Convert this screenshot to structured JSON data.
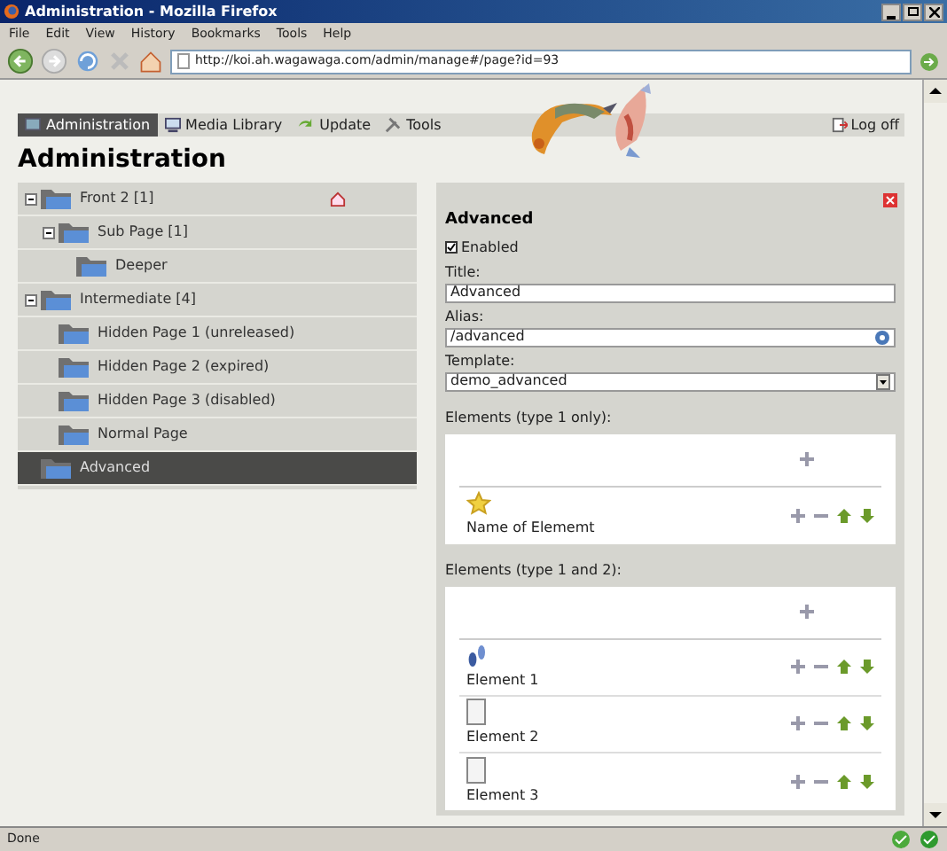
{
  "window": {
    "title": "Administration - Mozilla Firefox"
  },
  "menu": [
    "File",
    "Edit",
    "View",
    "History",
    "Bookmarks",
    "Tools",
    "Help"
  ],
  "address": {
    "value": "http://koi.ah.wagawaga.com/admin/manage#/page?id=93"
  },
  "nav": [
    {
      "label": "Administration",
      "selected": true,
      "kind": "admin"
    },
    {
      "label": "Media Library",
      "selected": false,
      "kind": "media"
    },
    {
      "label": "Update",
      "selected": false,
      "kind": "update"
    },
    {
      "label": "Tools",
      "selected": false,
      "kind": "tools"
    }
  ],
  "logoff": "Log off",
  "heading": "Administration",
  "tree": [
    {
      "label": "Front 2 [1]",
      "selected": false,
      "home": true,
      "expanded": true,
      "children": [
        {
          "label": "Sub Page [1]",
          "selected": false,
          "expanded": true,
          "children": [
            {
              "label": "Deeper",
              "selected": false
            }
          ]
        }
      ]
    },
    {
      "label": "Intermediate [4]",
      "selected": false,
      "expanded": true,
      "children": [
        {
          "label": "Hidden Page 1 (unreleased)",
          "selected": false
        },
        {
          "label": "Hidden Page 2 (expired)",
          "selected": false
        },
        {
          "label": "Hidden Page 3 (disabled)",
          "selected": false
        },
        {
          "label": "Normal Page",
          "selected": false
        }
      ]
    },
    {
      "label": "Advanced",
      "selected": true
    }
  ],
  "editor": {
    "title": "Advanced",
    "enabled": {
      "label": "Enabled",
      "checked": true
    },
    "fields": [
      {
        "label": "Title:",
        "value": "Advanced",
        "kind": "text"
      },
      {
        "label": "Alias:",
        "value": "/advanced",
        "kind": "help"
      },
      {
        "label": "Template:",
        "value": "demo_advanced",
        "kind": "select"
      }
    ],
    "groups": [
      {
        "label": "Elements (type 1 only):",
        "elements": [
          {
            "name": "Name of Elememt",
            "kind": "star"
          }
        ]
      },
      {
        "label": "Elements (type 1 and 2):",
        "elements": [
          {
            "name": "Element 1",
            "kind": "feet"
          },
          {
            "name": "Element 2",
            "kind": "page"
          },
          {
            "name": "Element 3",
            "kind": "page"
          }
        ]
      }
    ]
  },
  "status_bar": {
    "text": "Done"
  }
}
